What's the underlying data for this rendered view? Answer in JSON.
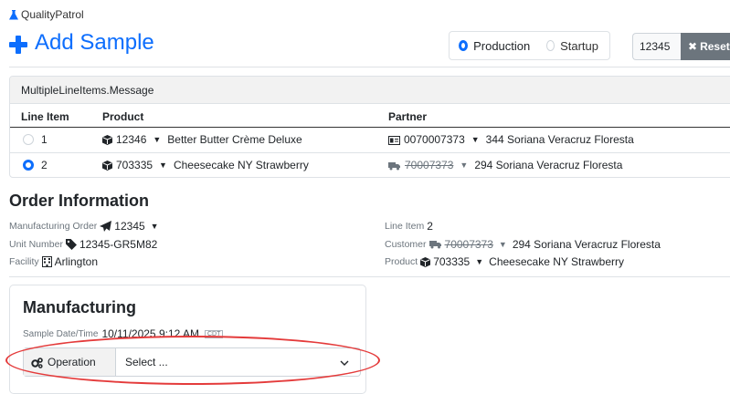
{
  "app": {
    "name": "QualityPatrol",
    "title": "Add Sample"
  },
  "mode": {
    "options": [
      "Production",
      "Startup"
    ],
    "selected": "Production"
  },
  "order_input": {
    "value": "12345"
  },
  "reset_label": "Reset",
  "line_items": {
    "header": "MultipleLineItems.Message",
    "columns": [
      "Line Item",
      "Product",
      "Partner"
    ],
    "rows": [
      {
        "selected": false,
        "number": "1",
        "product_code": "12346",
        "product_name": "Better Butter Crème Deluxe",
        "partner_code": "0070007373",
        "partner_name": "344 Soriana Veracruz Floresta",
        "partner_struck": false
      },
      {
        "selected": true,
        "number": "2",
        "product_code": "703335",
        "product_name": "Cheesecake NY Strawberry",
        "partner_code": "70007373",
        "partner_name": "294 Soriana Veracruz Floresta",
        "partner_struck": true
      }
    ]
  },
  "order_info": {
    "title": "Order Information",
    "manufacturing_order": {
      "label": "Manufacturing Order",
      "value": "12345"
    },
    "unit_number": {
      "label": "Unit Number",
      "value": "12345-GR5M82"
    },
    "facility": {
      "label": "Facility",
      "value": "Arlington"
    },
    "line_item": {
      "label": "Line Item",
      "value": "2"
    },
    "customer": {
      "label": "Customer",
      "code": "70007373",
      "name": "294 Soriana Veracruz Floresta"
    },
    "product": {
      "label": "Product",
      "code": "703335",
      "name": "Cheesecake NY Strawberry"
    }
  },
  "manufacturing": {
    "title": "Manufacturing",
    "sample_datetime_label": "Sample Date/Time",
    "sample_datetime": "10/11/2025 9:12 AM",
    "timezone": "CDT",
    "operation_label": "Operation",
    "operation_placeholder": "Select ..."
  },
  "colors": {
    "primary": "#0d6efd",
    "secondary": "#6c757d",
    "annotation": "#e43b3b"
  }
}
